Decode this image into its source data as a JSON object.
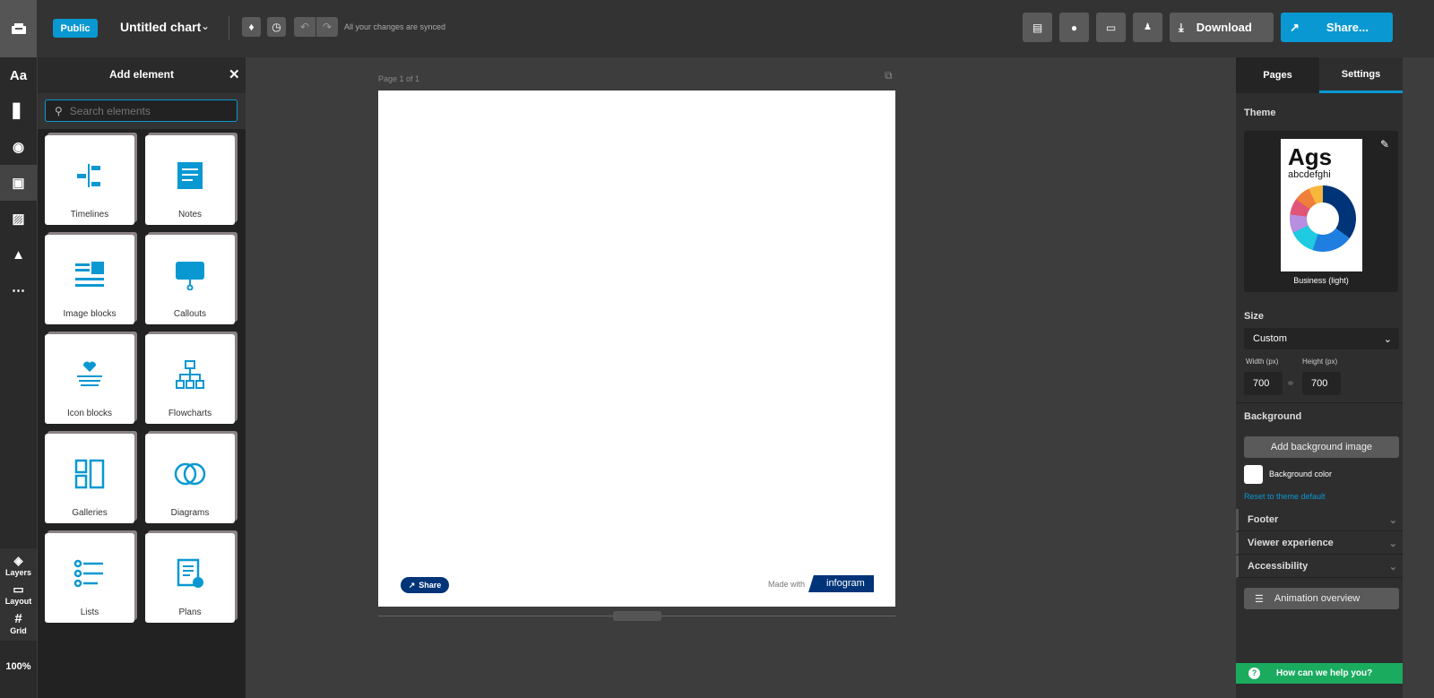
{
  "topbar": {
    "public_label": "Public",
    "title": "Untitled chart",
    "sync_status": "All your changes are synced",
    "download_label": "Download",
    "share_label": "Share..."
  },
  "rail": {
    "items": [
      "Aa"
    ],
    "layers": "Layers",
    "layout": "Layout",
    "grid": "Grid",
    "zoom": "100%"
  },
  "panel": {
    "title": "Add element",
    "search_placeholder": "Search elements",
    "elements": [
      "Timelines",
      "Notes",
      "Image blocks",
      "Callouts",
      "Icon blocks",
      "Flowcharts",
      "Galleries",
      "Diagrams",
      "Lists",
      "Plans"
    ]
  },
  "canvas": {
    "page_label": "Page 1 of 1",
    "share_label": "Share",
    "made_with": "Made with",
    "brand": "infogram"
  },
  "right": {
    "tabs": [
      "Pages",
      "Settings"
    ],
    "active_tab": "Settings",
    "theme_label": "Theme",
    "theme_sample": "Ags",
    "theme_sample_sub": "abcdefghi",
    "theme_name": "Business (light)",
    "size_label": "Size",
    "size_value": "Custom",
    "width_label": "Width (px)",
    "height_label": "Height (px)",
    "width": "700",
    "height": "700",
    "background_label": "Background",
    "add_bg_image": "Add background image",
    "bg_color_label": "Background color",
    "reset_label": "Reset to theme default",
    "sections": [
      "Footer",
      "Viewer experience",
      "Accessibility"
    ],
    "animation_label": "Animation overview",
    "help": "How can we help you?"
  },
  "colors": {
    "accent": "#0a98d2",
    "brand": "#003478",
    "help": "#1aab5f"
  }
}
